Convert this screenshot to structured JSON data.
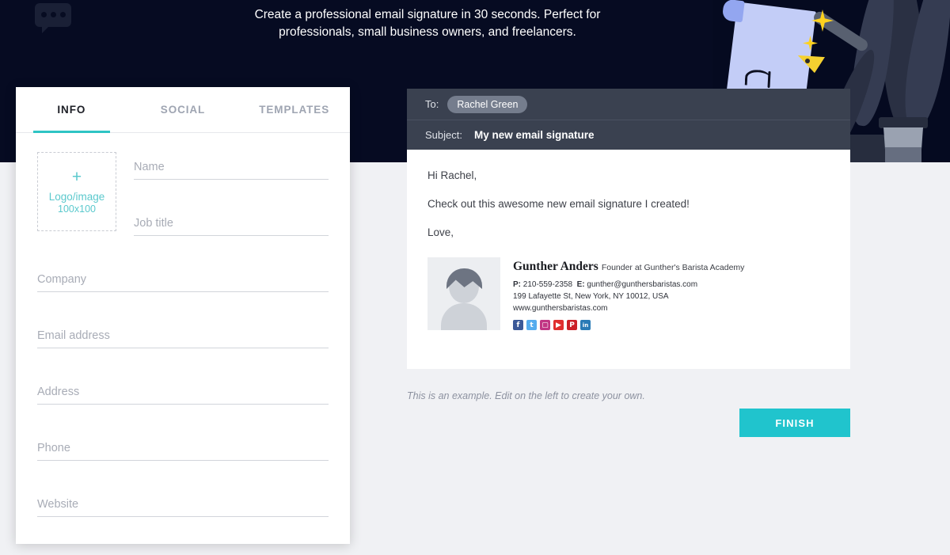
{
  "hero": {
    "tagline": "Create a professional email signature in 30 seconds. Perfect for professionals, small business owners, and freelancers.",
    "background_color": "#060b22",
    "chat_bubble_icon": "chat-bubble-icon",
    "illustration": {
      "name": "signed-document-with-pen-illustration",
      "paper_color": "#c3cdf7",
      "pen_color": "#586070",
      "nib_color": "#f5d130",
      "sparkle_color": "#ffd21e"
    }
  },
  "form": {
    "tabs": [
      {
        "label": "INFO",
        "active": true
      },
      {
        "label": "SOCIAL",
        "active": false
      },
      {
        "label": "TEMPLATES",
        "active": false
      }
    ],
    "accent_color": "#2ec4c4",
    "logo_upload": {
      "plus": "+",
      "label": "Logo/image",
      "size": "100x100"
    },
    "fields": [
      {
        "name": "name",
        "placeholder": "Name",
        "value": ""
      },
      {
        "name": "job-title",
        "placeholder": "Job title",
        "value": ""
      },
      {
        "name": "company",
        "placeholder": "Company",
        "value": ""
      },
      {
        "name": "email-address",
        "placeholder": "Email address",
        "value": ""
      },
      {
        "name": "address",
        "placeholder": "Address",
        "value": ""
      },
      {
        "name": "phone",
        "placeholder": "Phone",
        "value": ""
      },
      {
        "name": "website",
        "placeholder": "Website",
        "value": ""
      }
    ]
  },
  "preview": {
    "to_label": "To:",
    "recipient": "Rachel Green",
    "subject_label": "Subject:",
    "subject_value": "My new email signature",
    "body": {
      "greeting": "Hi Rachel,",
      "message": "Check out this awesome new email signature I created!",
      "signoff": "Love,"
    },
    "signature": {
      "avatar_icon": "person-avatar-placeholder",
      "name": "Gunther Anders",
      "role": "Founder at Gunther's Barista Academy",
      "phone_label": "P:",
      "phone": "210-559-2358",
      "email_label": "E:",
      "email": "gunther@gunthersbaristas.com",
      "address": "199 Lafayette St, New York, NY 10012, USA",
      "website": "www.gunthersbaristas.com",
      "socials": [
        {
          "name": "facebook-icon",
          "glyph": "f",
          "color": "#3b5998"
        },
        {
          "name": "twitter-icon",
          "glyph": "t",
          "color": "#55acee"
        },
        {
          "name": "instagram-icon",
          "glyph": "▢",
          "color": "#c13584"
        },
        {
          "name": "youtube-icon",
          "glyph": "▶",
          "color": "#e02f2f"
        },
        {
          "name": "pinterest-icon",
          "glyph": "P",
          "color": "#cb2027"
        },
        {
          "name": "linkedin-icon",
          "glyph": "in",
          "color": "#2a7bb6"
        }
      ]
    }
  },
  "footer": {
    "note": "This is an example. Edit on the left to create your own.",
    "finish_label": "FINISH",
    "finish_color": "#20c4cd"
  }
}
